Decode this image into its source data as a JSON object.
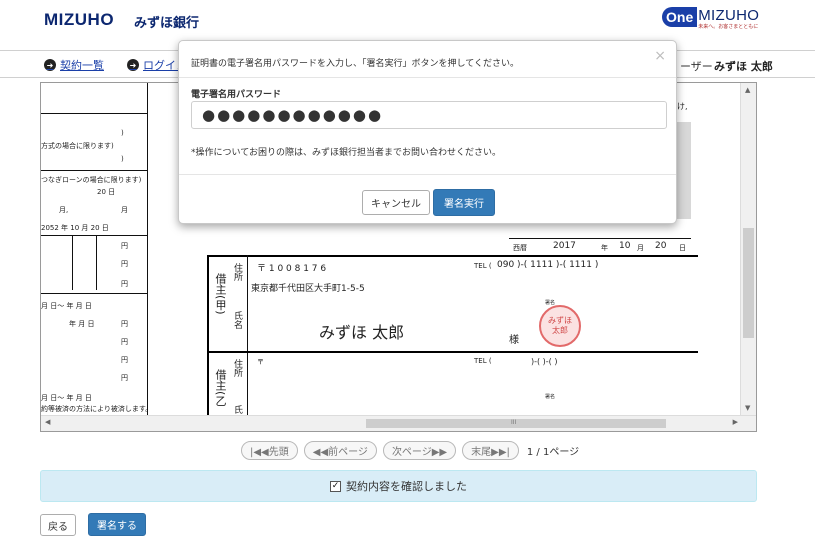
{
  "header": {
    "brand": "MIZUHO",
    "bank_name": "みずほ銀行",
    "one_mizuho": {
      "one": "One",
      "word": "MIZUHO",
      "tagline": "未来へ。お客さまとともに"
    }
  },
  "nav": {
    "contract_list": "契約一覧",
    "login_truncated": "ログイン月",
    "user_label_partial": "ーザー",
    "user_name": "みずほ 太郎"
  },
  "document": {
    "left_lines": [
      ")",
      "方式の場合に限ります)",
      ")",
      "つなぎローンの場合に限ります)",
      "20 日",
      "月,",
      "月",
      "2052 年 10 月 20 日",
      "円",
      "円",
      "円",
      "円",
      "月 日～ 年 月 日",
      "年 月 日",
      "円",
      "円",
      "円",
      "月 日～ 年 月 日",
      "約等被済の方法により被済します。"
    ],
    "right_partial": "け,",
    "date": {
      "era": "西暦",
      "year": "2017",
      "year_unit": "年",
      "month": "10",
      "month_unit": "月",
      "day": "20",
      "day_unit": "日"
    },
    "borrower_a": {
      "role": "借主(甲)",
      "address_label": "住所",
      "name_label": "氏名",
      "postal": "〒 1 0 0 8 1 7 6",
      "address": "東京都千代田区大手町1-5-5",
      "tel_label": "TEL (",
      "tel": "090 )-( 1111 )-( 1111 )",
      "seal_label": "署名",
      "name": "みずほ 太郎",
      "sama": "様",
      "stamp_top": "みずほ",
      "stamp_bottom": "太郎"
    },
    "borrower_b": {
      "role": "借主(乙",
      "address_label": "住所",
      "name_label": "氏",
      "postal": "〒",
      "tel_label": "TEL (",
      "tel_blank": ")-( )-( )",
      "seal_label": "署名"
    },
    "scroll_mid_mark": "III"
  },
  "pager": {
    "first": "|◀◀先頭",
    "prev": "◀◀前ページ",
    "next": "次ページ▶▶",
    "last": "末尾▶▶|",
    "info": "1 / 1ページ"
  },
  "confirm": {
    "checked": true,
    "check_mark": "✓",
    "label": "契約内容を確認しました"
  },
  "actions": {
    "back": "戻る",
    "sign": "署名する"
  },
  "modal": {
    "message": "証明書の電子署名用パスワードを入力し、「署名実行」ボタンを押してください。",
    "close": "×",
    "password_label": "電子署名用パスワード",
    "password_value": "●●●●●●●●●●●●",
    "help": "*操作についてお困りの際は、みずほ銀行担当者までお問い合わせください。",
    "cancel": "キャンセル",
    "ok": "署名実行"
  },
  "colors": {
    "brand_blue": "#0c2770",
    "primary_btn": "#337ab7",
    "info_bg": "#d9edf7",
    "stamp_red": "#e26a6a"
  }
}
